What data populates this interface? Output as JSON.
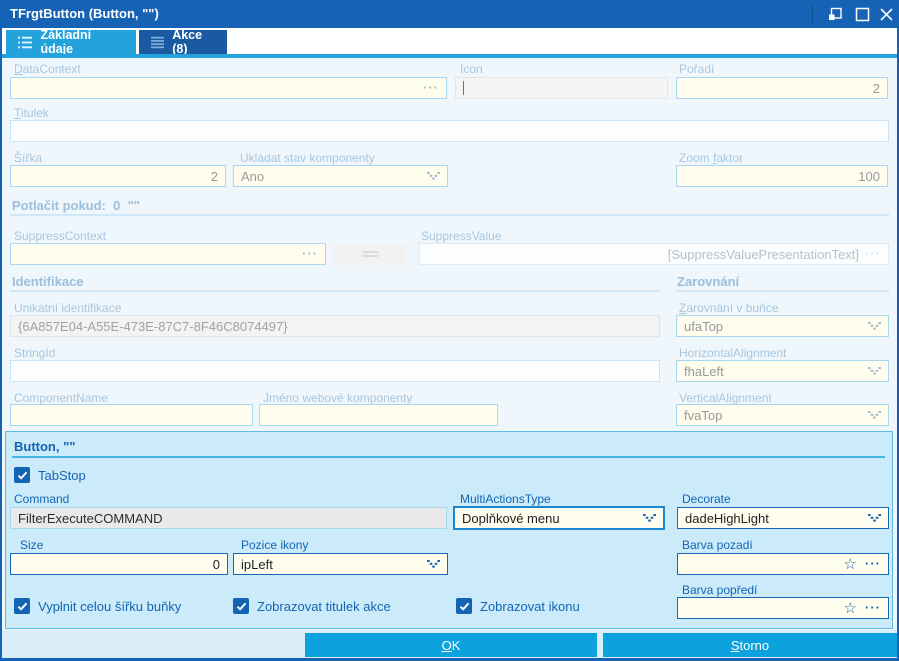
{
  "window": {
    "title": "TFrgtButton (Button, \"\")"
  },
  "tabs": {
    "basic": "Základní údaje",
    "actions": "Akce (8)"
  },
  "icons": {
    "ellipsis": "···",
    "star": "☆"
  },
  "general": {
    "datacontext_label": "DataContext",
    "datacontext_value": "",
    "icon_label": "Icon",
    "icon_value": "",
    "poradi_label": "Pořadí",
    "poradi_value": "2",
    "titulek_label": "Titulek",
    "titulek_value": "",
    "sirka_label": "Šířka",
    "sirka_value": "2",
    "ukladat_label": "Ukládat stav komponenty",
    "ukladat_value": "Ano",
    "zoomfaktor_label": "Zoom faktor",
    "zoomfaktor_value": "100",
    "potlacit_header": "Potlačit pokud:  0  \"\"",
    "suppresscontext_label": "SuppressContext",
    "suppresscontext_value": "",
    "suppressvalue_label": "SuppressValue",
    "suppressvalue_value": "[SuppressValuePresentationText]"
  },
  "identifikace": {
    "header": "Identifikace",
    "unikatni_label": "Unikátní identifikace",
    "unikatni_value": "{6A857E04-A55E-473E-87C7-8F46C8074497}",
    "stringid_label": "StringId",
    "stringid_value": "",
    "componentname_label": "ComponentName",
    "componentname_value": "",
    "webname_label": "Jméno webové komponenty",
    "webname_value": ""
  },
  "zarovnani": {
    "header": "Zarovnání",
    "bunka_label": "Zarovnání v buňce",
    "bunka_value": "ufaTop",
    "horizontal_label": "HorizontalAlignment",
    "horizontal_value": "fhaLeft",
    "vertical_label": "VerticalAlignment",
    "vertical_value": "fvaTop"
  },
  "button_section": {
    "header": "Button, \"\"",
    "tabstop_label": "TabStop",
    "tabstop_checked": true,
    "command_label": "Command",
    "command_value": "FilterExecuteCOMMAND",
    "multiactions_label": "MultiActionsType",
    "multiactions_value": "Doplňkové menu",
    "decorate_label": "Decorate",
    "decorate_value": "dadeHighLight",
    "size_label": "Size",
    "size_value": "0",
    "pozice_label": "Pozice ikony",
    "pozice_value": "ipLeft",
    "barva_pozadi_label": "Barva pozadí",
    "barva_pozadi_value": "",
    "barva_popredi_label": "Barva popředí",
    "barva_popredi_value": "",
    "cb_fill_label": "Vyplnit celou šířku buňky",
    "cb_fill_checked": true,
    "cb_title_label": "Zobrazovat titulek akce",
    "cb_title_checked": true,
    "cb_icon_label": "Zobrazovat ikonu",
    "cb_icon_checked": true
  },
  "footer": {
    "ok": "OK",
    "storno": "Storno"
  },
  "colors": {
    "titlebar": "#1663B5",
    "tab_active": "#23A2DC",
    "tab_inactive": "#1A5AA0",
    "accent_blue": "#1464B4",
    "button_blue": "#0BA2DE",
    "field_cream": "#FEFDEE",
    "panel_bg": "#CBEBFA",
    "content_bg": "#EFF7FC"
  }
}
